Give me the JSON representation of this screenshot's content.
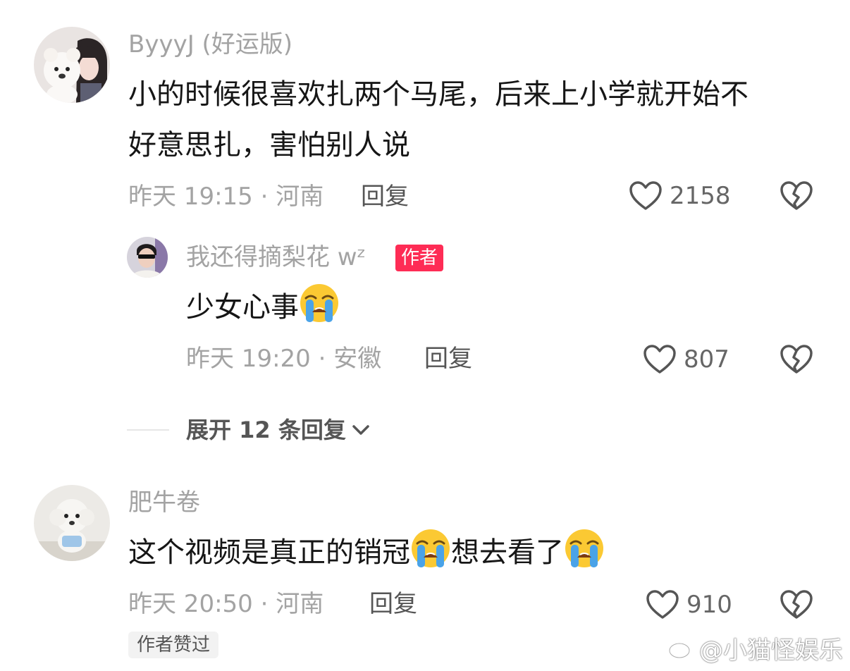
{
  "comments": [
    {
      "username": "ByyyJ (好运版)",
      "content_lines": [
        "小的时候很喜欢扎两个马尾，后来上小学就开始不",
        "好意思扎，害怕别人说"
      ],
      "meta": "昨天 19:15 · 河南",
      "reply_label": "回复",
      "likes": "2158",
      "avatar_icon": "girl-with-plush-avatar",
      "replies": [
        {
          "username": "我还得摘梨花 wᶻ",
          "badge": "作者",
          "content": "少女心事",
          "emoji": "loudly-crying-face",
          "meta": "昨天 19:20 · 安徽",
          "reply_label": "回复",
          "likes": "807",
          "avatar_icon": "man-sunglasses-avatar"
        }
      ],
      "expand_label": "展开 12 条回复"
    },
    {
      "username": "肥牛卷",
      "content_part1": "这个视频是真正的销冠",
      "content_part2": "想去看了",
      "meta": "昨天 20:50 · 河南",
      "reply_label": "回复",
      "likes": "910",
      "avatar_icon": "white-puppy-plush-avatar",
      "author_liked_label": "作者赞过"
    }
  ],
  "watermark": "@小猫怪娱乐",
  "colors": {
    "text_primary": "#161616",
    "text_secondary": "#a3a3a3",
    "badge_red": "#fe2c55",
    "icon_gray": "#555555"
  }
}
